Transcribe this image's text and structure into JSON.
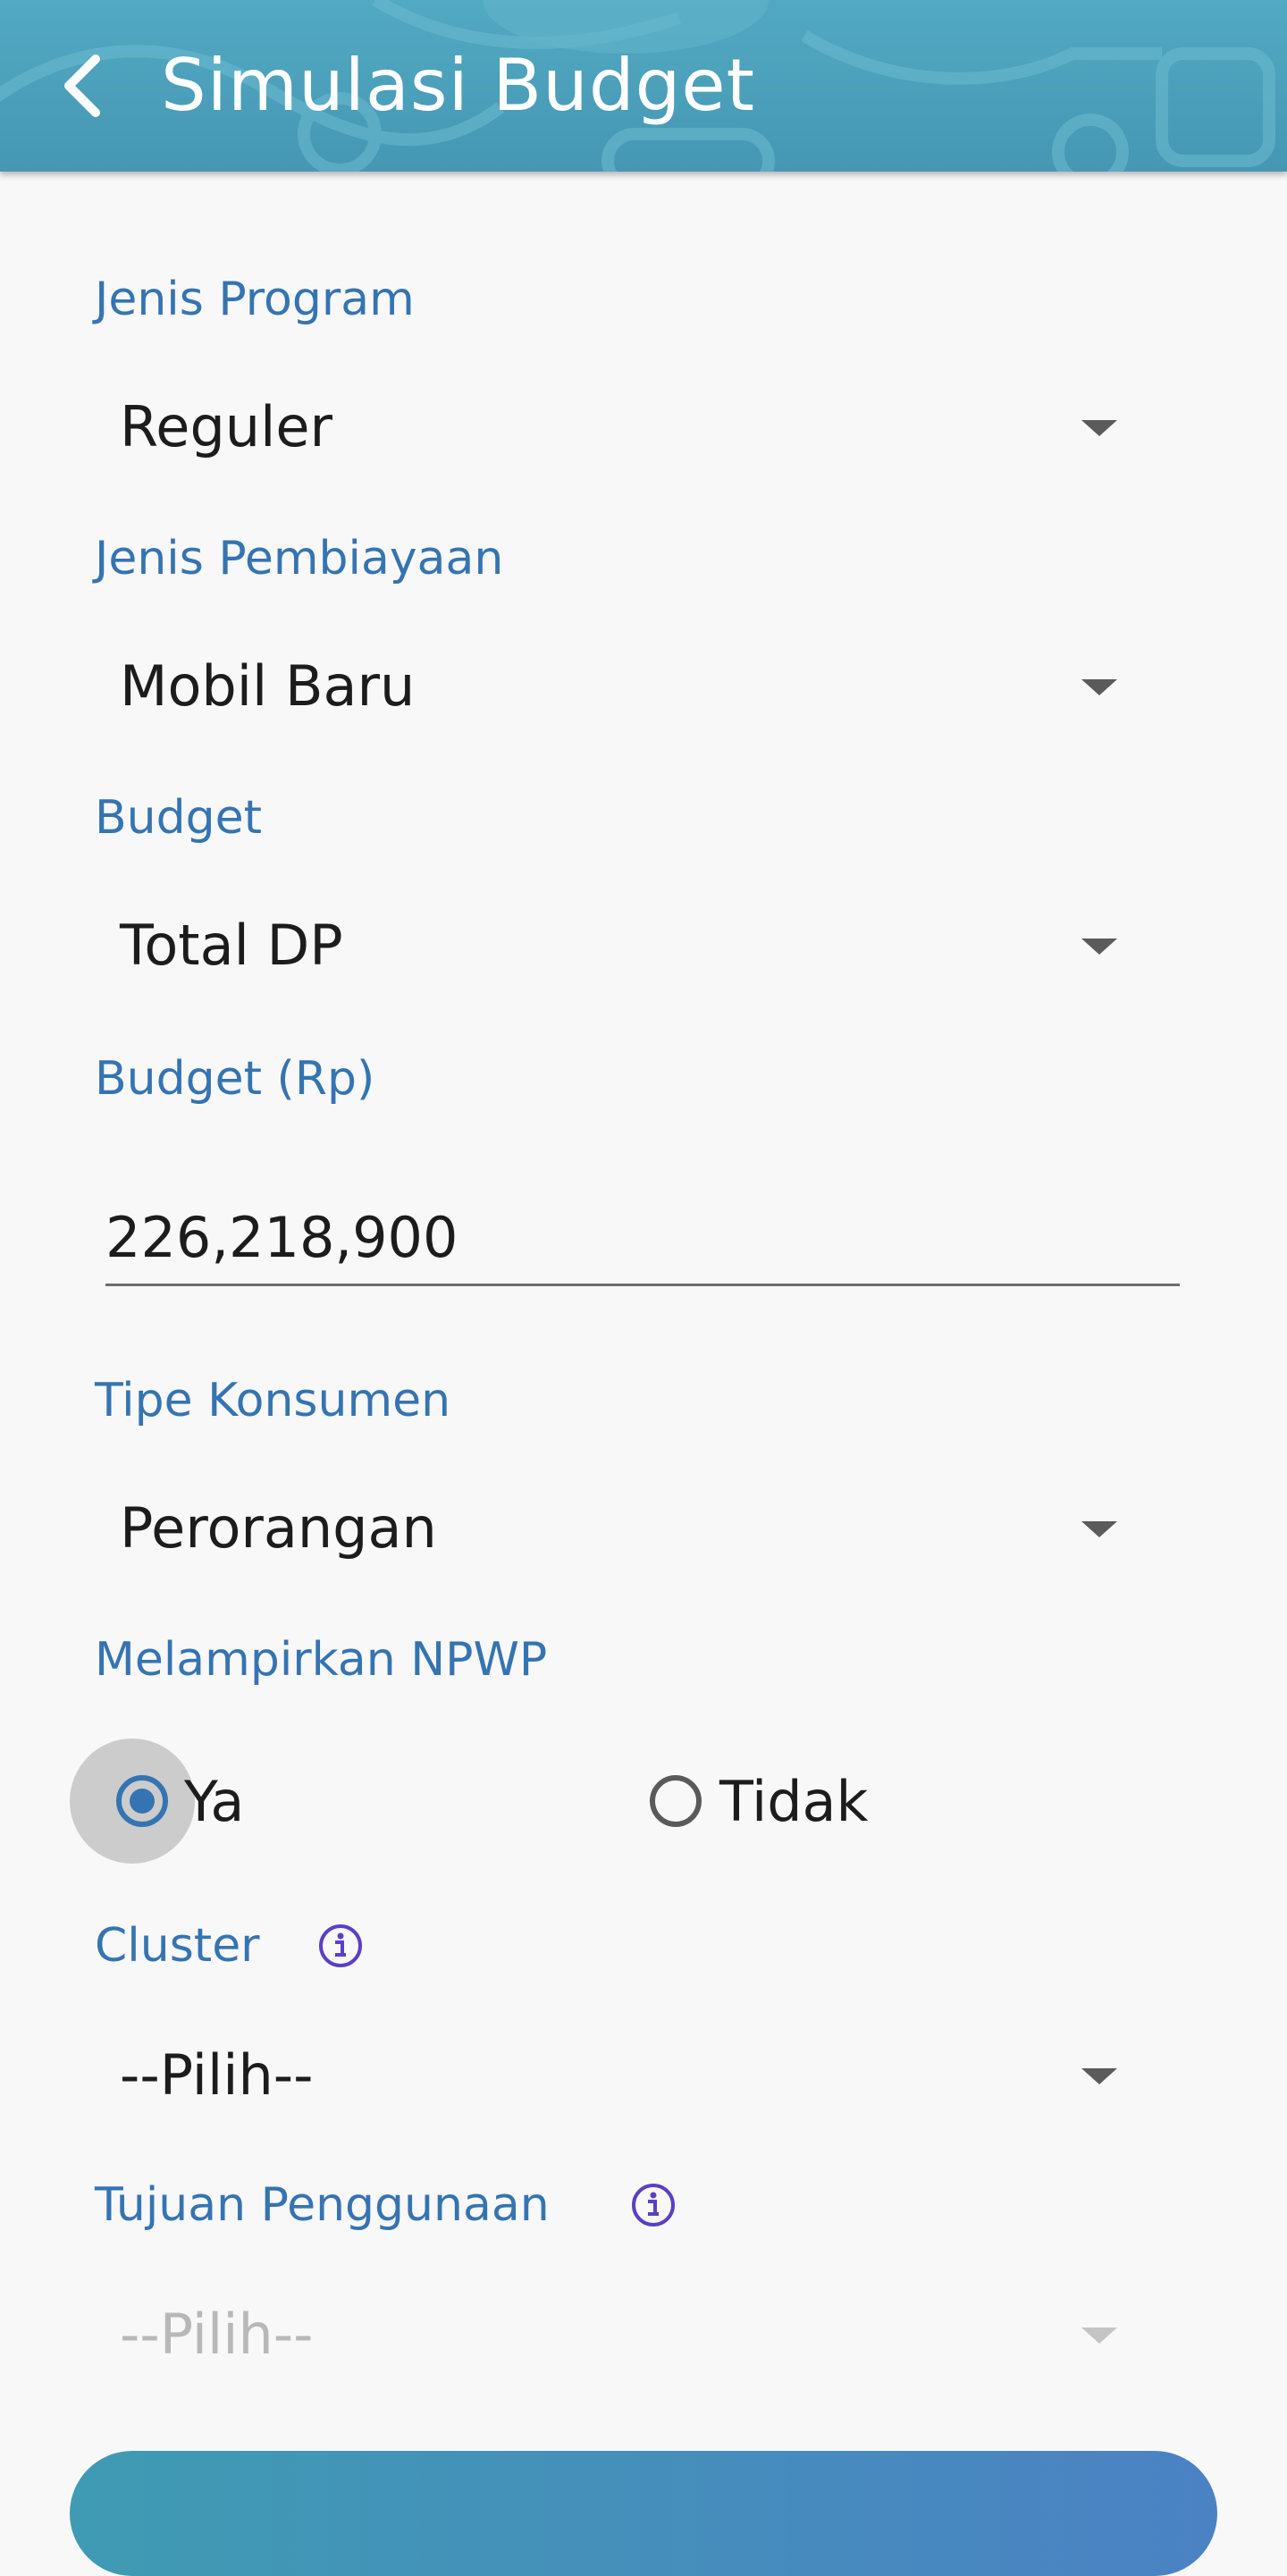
{
  "header": {
    "title": "Simulasi Budget"
  },
  "form": {
    "jenis_program": {
      "label": "Jenis Program",
      "value": "Reguler"
    },
    "jenis_pembiayaan": {
      "label": "Jenis Pembiayaan",
      "value": "Mobil Baru"
    },
    "budget": {
      "label": "Budget",
      "value": "Total DP"
    },
    "budget_rp": {
      "label": "Budget (Rp)",
      "value": "226,218,900"
    },
    "tipe_konsumen": {
      "label": "Tipe Konsumen",
      "value": "Perorangan"
    },
    "npwp": {
      "label": "Melampirkan NPWP",
      "options": [
        "Ya",
        "Tidak"
      ],
      "selected": "Ya"
    },
    "cluster": {
      "label": "Cluster",
      "value": "--Pilih--"
    },
    "tujuan_penggunaan": {
      "label": "Tujuan Penggunaan",
      "value": "--Pilih--",
      "disabled": true
    }
  },
  "colors": {
    "accent": "#3574b2",
    "header": "#4da2bc",
    "info_icon": "#5b3fc4"
  },
  "icons": {
    "back": "chevron-left-icon",
    "info": "info-icon",
    "dropdown": "caret-down-icon"
  }
}
